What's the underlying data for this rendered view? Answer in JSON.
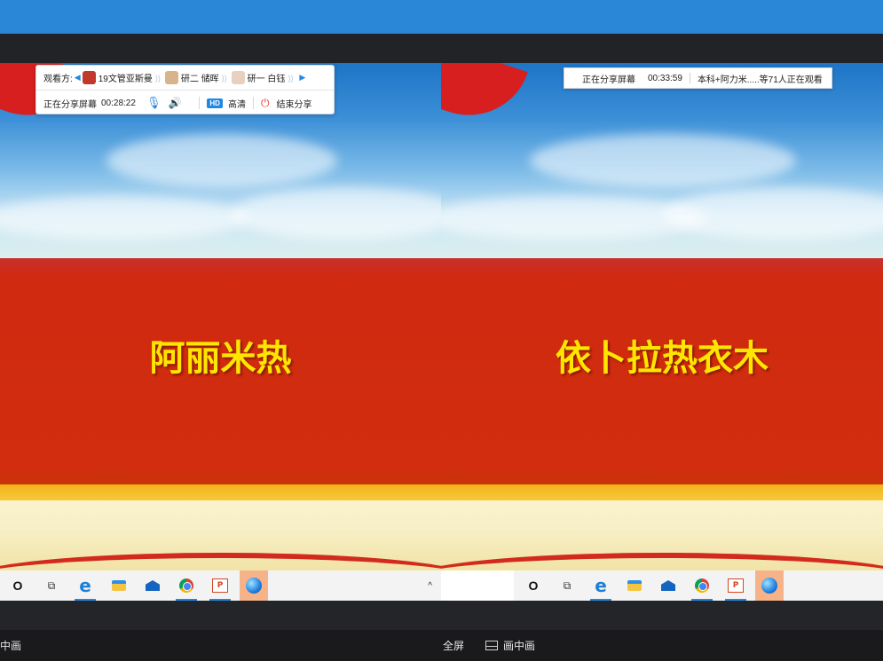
{
  "left_panel": {
    "toolbar": {
      "viewers_label": "观看方:",
      "viewers": [
        {
          "name": "19文管亚斯曼",
          "avatar_color": "#c0392b"
        },
        {
          "name": "研二 储晖",
          "avatar_color": "#d9b38c"
        },
        {
          "name": "研一 白钰",
          "avatar_color": "#e8d0c0"
        }
      ],
      "sharing_label": "正在分享屏幕",
      "timer": "00:28:22",
      "hd_badge": "HD",
      "hd_label": "高清",
      "end_share_label": "结束分享"
    },
    "slide_name": "阿丽米热",
    "footer_label": "中画"
  },
  "right_panel": {
    "status_bar": {
      "sharing_label": "正在分享屏幕",
      "timer": "00:33:59",
      "viewers_text": "本科+阿力米.....等71人正在观看"
    },
    "slide_name": "依卜拉热衣木",
    "footer": {
      "fullscreen_label": "全屏",
      "pip_label": "画中画"
    }
  },
  "taskbar": {
    "icons": [
      "cortana-icon",
      "task-view-icon",
      "edge-icon",
      "file-explorer-icon",
      "mail-icon",
      "chrome-icon",
      "powerpoint-icon",
      "browser-icon"
    ],
    "ppt_glyph": "P",
    "edge_glyph": "e"
  },
  "colors": {
    "header_blue": "#2a86d6",
    "slide_red": "#d12d0e",
    "slide_name_yellow": "#ffe600",
    "accent_blue": "#1e88e5",
    "end_red": "#e53935"
  }
}
